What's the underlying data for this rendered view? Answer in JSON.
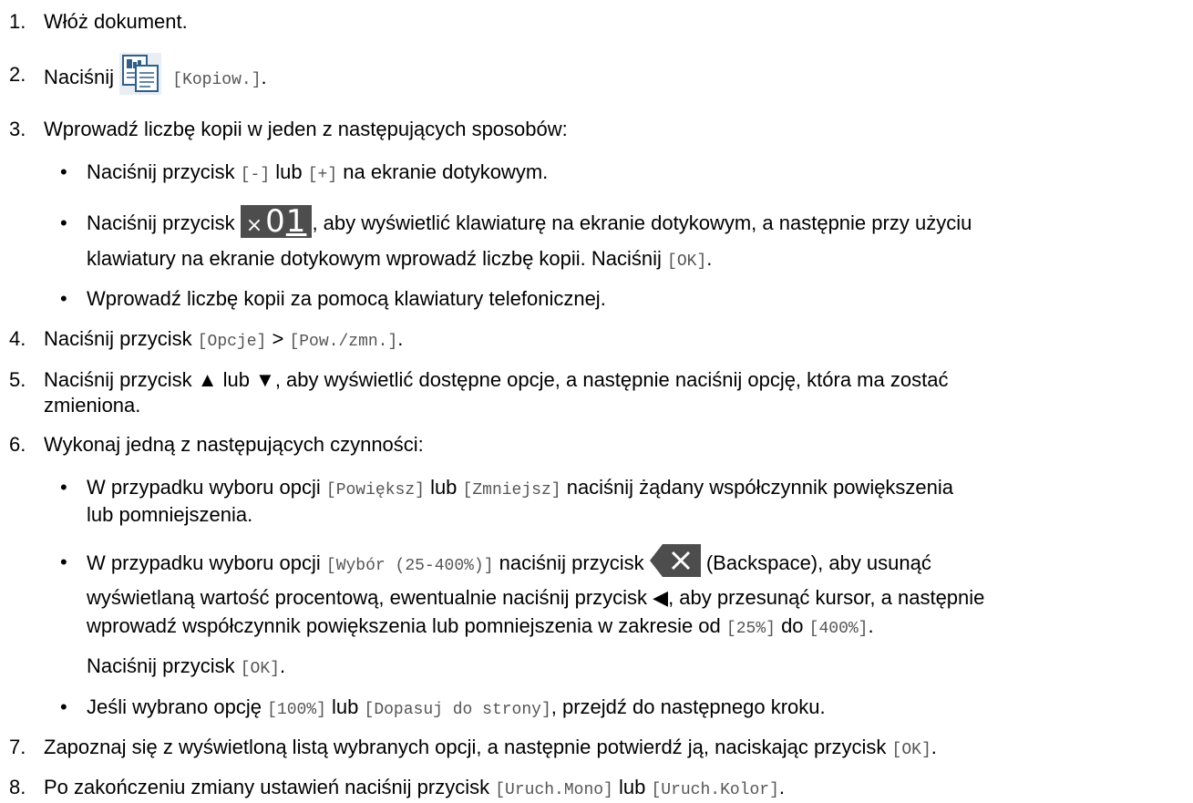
{
  "steps": [
    {
      "num": "1.",
      "text": "Włóż dokument."
    },
    {
      "num": "2.",
      "text_pre": "Naciśnij",
      "icon": "copy-icon",
      "mono": "[Kopiow.]",
      "text_post": "."
    },
    {
      "num": "3.",
      "text": "Wprowadź liczbę kopii w jeden z następujących sposobów:"
    },
    {
      "num": "4.",
      "text_pre": "Naciśnij przycisk",
      "mono1": "[Opcje]",
      "mid": ">",
      "mono2": "[Pow./zmn.]",
      "text_post": "."
    },
    {
      "num": "5.",
      "line1": "Naciśnij przycisk ▲ lub ▼, aby wyświetlić dostępne opcje, a następnie naciśnij opcję, która ma zostać",
      "line2": "zmieniona."
    },
    {
      "num": "6.",
      "text": "Wykonaj jedną z następujących czynności:"
    },
    {
      "num": "7.",
      "text_pre": "Zapoznaj się z wyświetloną listą wybranych opcji, a następnie potwierdź ją, naciskając przycisk",
      "mono": "[OK]",
      "text_post": "."
    },
    {
      "num": "8.",
      "text_pre": "Po zakończeniu zmiany ustawień naciśnij przycisk",
      "mono1": "[Uruch.Mono]",
      "mid": "lub",
      "mono2": "[Uruch.Kolor]",
      "text_post": "."
    }
  ],
  "step3_bullets": [
    {
      "a": "Naciśnij przycisk",
      "m1": "[-]",
      "b": "lub",
      "m2": "[+]",
      "c": "na ekranie dotykowym."
    },
    {
      "a": "Naciśnij przycisk",
      "icon_x": "×",
      "icon_num": "0",
      "icon_num_u": "1",
      "b": ", aby wyświetlić klawiaturę na ekranie dotykowym, a następnie przy użyciu",
      "line2": "klawiatury na ekranie dotykowym wprowadź liczbę kopii. Naciśnij",
      "m": "[OK]",
      "c": "."
    },
    {
      "a": "Wprowadź liczbę kopii za pomocą klawiatury telefonicznej."
    }
  ],
  "step6_bullets": [
    {
      "a": "W przypadku wyboru opcji",
      "m1": "[Powiększ]",
      "b": "lub",
      "m2": "[Zmniejsz]",
      "c": "naciśnij żądany współczynnik powiększenia",
      "line2": "lub pomniejszenia."
    },
    {
      "a": "W przypadku wyboru opcji",
      "m1": "[Wybór (25-400%)]",
      "b": "naciśnij przycisk",
      "c": "(Backspace), aby usunąć",
      "line2": "wyświetlaną wartość procentową, ewentualnie naciśnij przycisk ◀, aby przesunąć kursor, a następnie",
      "line3_a": "wprowadź współczynnik powiększenia lub pomniejszenia w zakresie od",
      "line3_m1": "[25%]",
      "line3_b": "do",
      "line3_m2": "[400%]",
      "line3_c": ".",
      "line4_a": "Naciśnij przycisk",
      "line4_m": "[OK]",
      "line4_c": "."
    },
    {
      "a": "Jeśli wybrano opcję",
      "m1": "[100%]",
      "b": "lub",
      "m2": "[Dopasuj do strony]",
      "c": ", przejdź do następnego kroku."
    }
  ],
  "bullet_char": "•",
  "colors": {
    "text": "#000000",
    "mono": "#555555",
    "icon_dark": "#4d4d4d"
  }
}
